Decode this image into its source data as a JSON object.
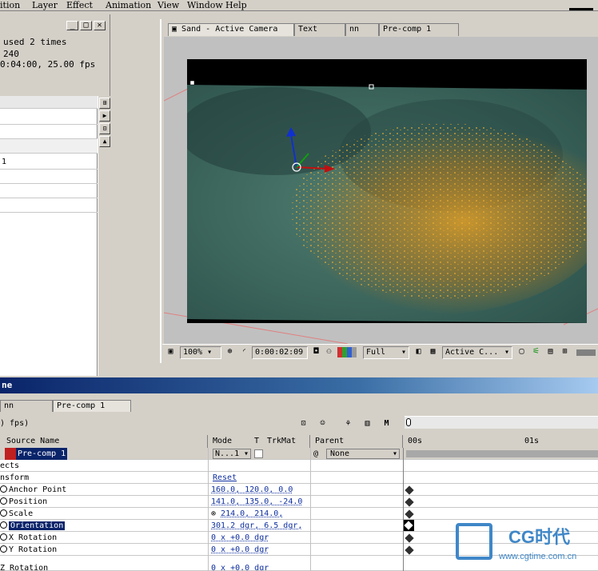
{
  "menu": [
    "ition",
    "Layer",
    "Effect",
    "Animation",
    "View",
    "Window",
    "Help"
  ],
  "project": {
    "info_line1": "used 2 times",
    "info_line2": "240",
    "info_line3": "0:04:00, 25.00 fps",
    "list_item": "1",
    "win_buttons": [
      "_",
      "□",
      "✕"
    ]
  },
  "comp": {
    "tabs": [
      "Sand - Active Camera",
      "Text",
      "nn",
      "Pre-comp 1"
    ],
    "toolbar": {
      "zoom": "100%",
      "timecode": "0:00:02:09",
      "resolution": "Full",
      "view": "Active C..."
    }
  },
  "timeline": {
    "title": "ne",
    "tabs": [
      "nn",
      "Pre-comp 1"
    ],
    "fps_label": ") fps)",
    "headers": {
      "source_name": "Source Name",
      "mode": "Mode",
      "t": "T",
      "trkmat": "TrkMat",
      "parent": "Parent"
    },
    "ruler": {
      "start": "00s",
      "mark1": "01s"
    },
    "layer": {
      "name": "Pre-comp 1",
      "mode": "N...1",
      "parent": "None"
    },
    "rows": [
      {
        "name": "ects",
        "value": ""
      },
      {
        "name": "nsform",
        "value": "Reset"
      },
      {
        "name": "Anchor Point",
        "value": "160.0, 120.0, 0.0",
        "kf": true
      },
      {
        "name": "Position",
        "value": "141.0, 135.0, -24.0",
        "kf": true
      },
      {
        "name": "Scale",
        "value": "214.0, 214.0,",
        "kf": true,
        "link": true
      },
      {
        "name": "Orientation",
        "value": "301.2 dgr, 6.5 dgr,",
        "kf": true,
        "selected": true
      },
      {
        "name": "X Rotation",
        "value": "0 x +0.0 dgr",
        "kf": true
      },
      {
        "name": "Y Rotation",
        "value": "0 x +0.0 dgr",
        "kf": true
      }
    ],
    "extra_row": {
      "name": "Z Rotation",
      "value": "0 x +0.0 dgr"
    }
  },
  "watermark": {
    "brand": "CG时代",
    "url": "www.cgtime.com.cn"
  },
  "colors": {
    "teal": "#3f6f62",
    "orange": "#e0a020",
    "title_blue": "#0a246a"
  }
}
